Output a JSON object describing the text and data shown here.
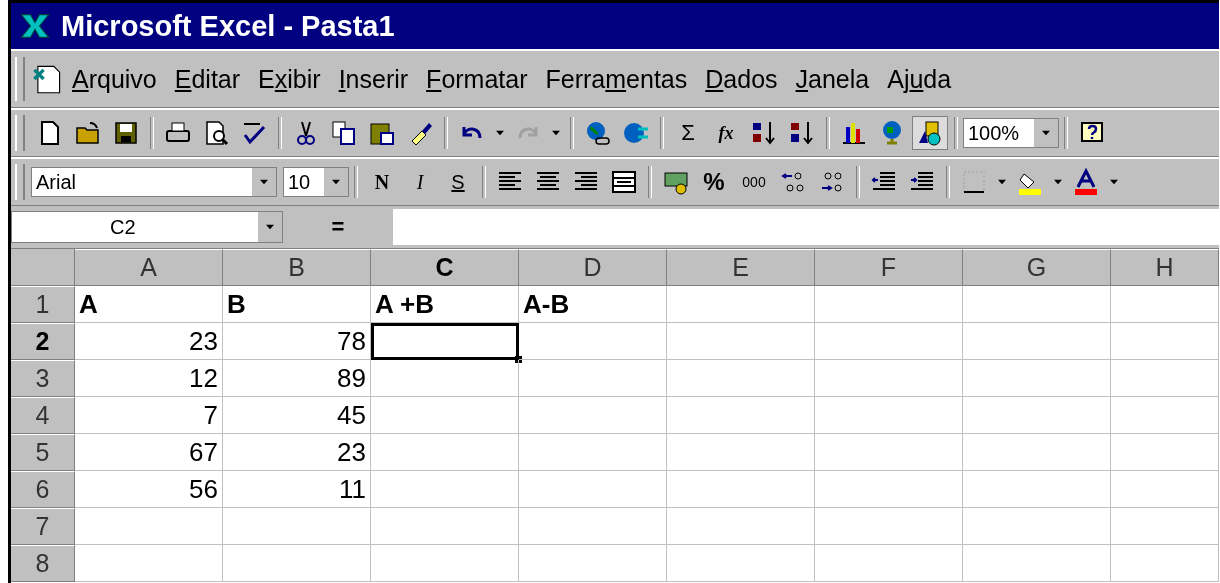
{
  "window": {
    "title": "Microsoft Excel - Pasta1"
  },
  "menu": [
    {
      "key": "A",
      "post": "rquivo"
    },
    {
      "key": "E",
      "post": "ditar"
    },
    {
      "pre": "E",
      "key": "x",
      "post": "ibir"
    },
    {
      "key": "I",
      "post": "nserir"
    },
    {
      "key": "F",
      "post": "ormatar"
    },
    {
      "pre": "Ferra",
      "key": "m",
      "post": "entas"
    },
    {
      "key": "D",
      "post": "ados"
    },
    {
      "key": "J",
      "post": "anela"
    },
    {
      "pre": "Aj",
      "key": "u",
      "post": "da"
    }
  ],
  "standard_toolbar": {
    "autosum": "Σ",
    "function": "fx",
    "zoom": "100%"
  },
  "formatting_toolbar": {
    "font": "Arial",
    "size": "10",
    "style_buttons": [
      "N",
      "I",
      "S"
    ],
    "percent": "%",
    "thousands": "000"
  },
  "formula_bar": {
    "name_box": "C2",
    "equals": "="
  },
  "columns": [
    {
      "label": "A",
      "selected": false
    },
    {
      "label": "B",
      "selected": false
    },
    {
      "label": "C",
      "selected": true
    },
    {
      "label": "D",
      "selected": false
    },
    {
      "label": "E",
      "selected": false
    },
    {
      "label": "F",
      "selected": false
    },
    {
      "label": "G",
      "selected": false
    },
    {
      "label": "H",
      "selected": false
    }
  ],
  "rows": [
    {
      "header": "1",
      "selected": false,
      "cells": [
        {
          "value": "A",
          "kind": "text"
        },
        {
          "value": "B",
          "kind": "text"
        },
        {
          "value": "A +B",
          "kind": "text"
        },
        {
          "value": "A-B",
          "kind": "text"
        }
      ]
    },
    {
      "header": "2",
      "selected": true,
      "cells": [
        {
          "value": "23",
          "kind": "number"
        },
        {
          "value": "78",
          "kind": "number"
        }
      ]
    },
    {
      "header": "3",
      "selected": false,
      "cells": [
        {
          "value": "12",
          "kind": "number"
        },
        {
          "value": "89",
          "kind": "number"
        }
      ]
    },
    {
      "header": "4",
      "selected": false,
      "cells": [
        {
          "value": "7",
          "kind": "number"
        },
        {
          "value": "45",
          "kind": "number"
        }
      ]
    },
    {
      "header": "5",
      "selected": false,
      "cells": [
        {
          "value": "67",
          "kind": "number"
        },
        {
          "value": "23",
          "kind": "number"
        }
      ]
    },
    {
      "header": "6",
      "selected": false,
      "cells": [
        {
          "value": "56",
          "kind": "number"
        },
        {
          "value": "11",
          "kind": "number"
        }
      ]
    },
    {
      "header": "7",
      "selected": false
    },
    {
      "header": "8",
      "selected": false
    }
  ]
}
